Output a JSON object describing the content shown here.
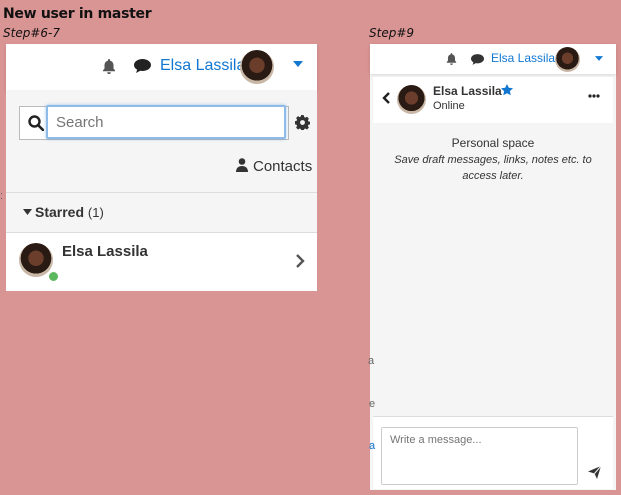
{
  "doc_title": "New user in master",
  "left": {
    "step": "Step#6-7",
    "user_name": "Elsa Lassila",
    "search_placeholder": "Search",
    "contacts_label": "Contacts",
    "starred_label": "Starred",
    "starred_count": "(1)",
    "contact_name": "Elsa Lassila"
  },
  "right": {
    "step": "Step#9",
    "user_name": "Elsa Lassila",
    "conv_name": "Elsa Lassila",
    "status": "Online",
    "personal_space_title": "Personal space",
    "personal_space_desc": "Save draft messages, links, notes etc. to access later.",
    "message_placeholder": "Write a message..."
  },
  "colors": {
    "background": "#d99494",
    "accent": "#1177d1",
    "online": "#5cb85c"
  }
}
